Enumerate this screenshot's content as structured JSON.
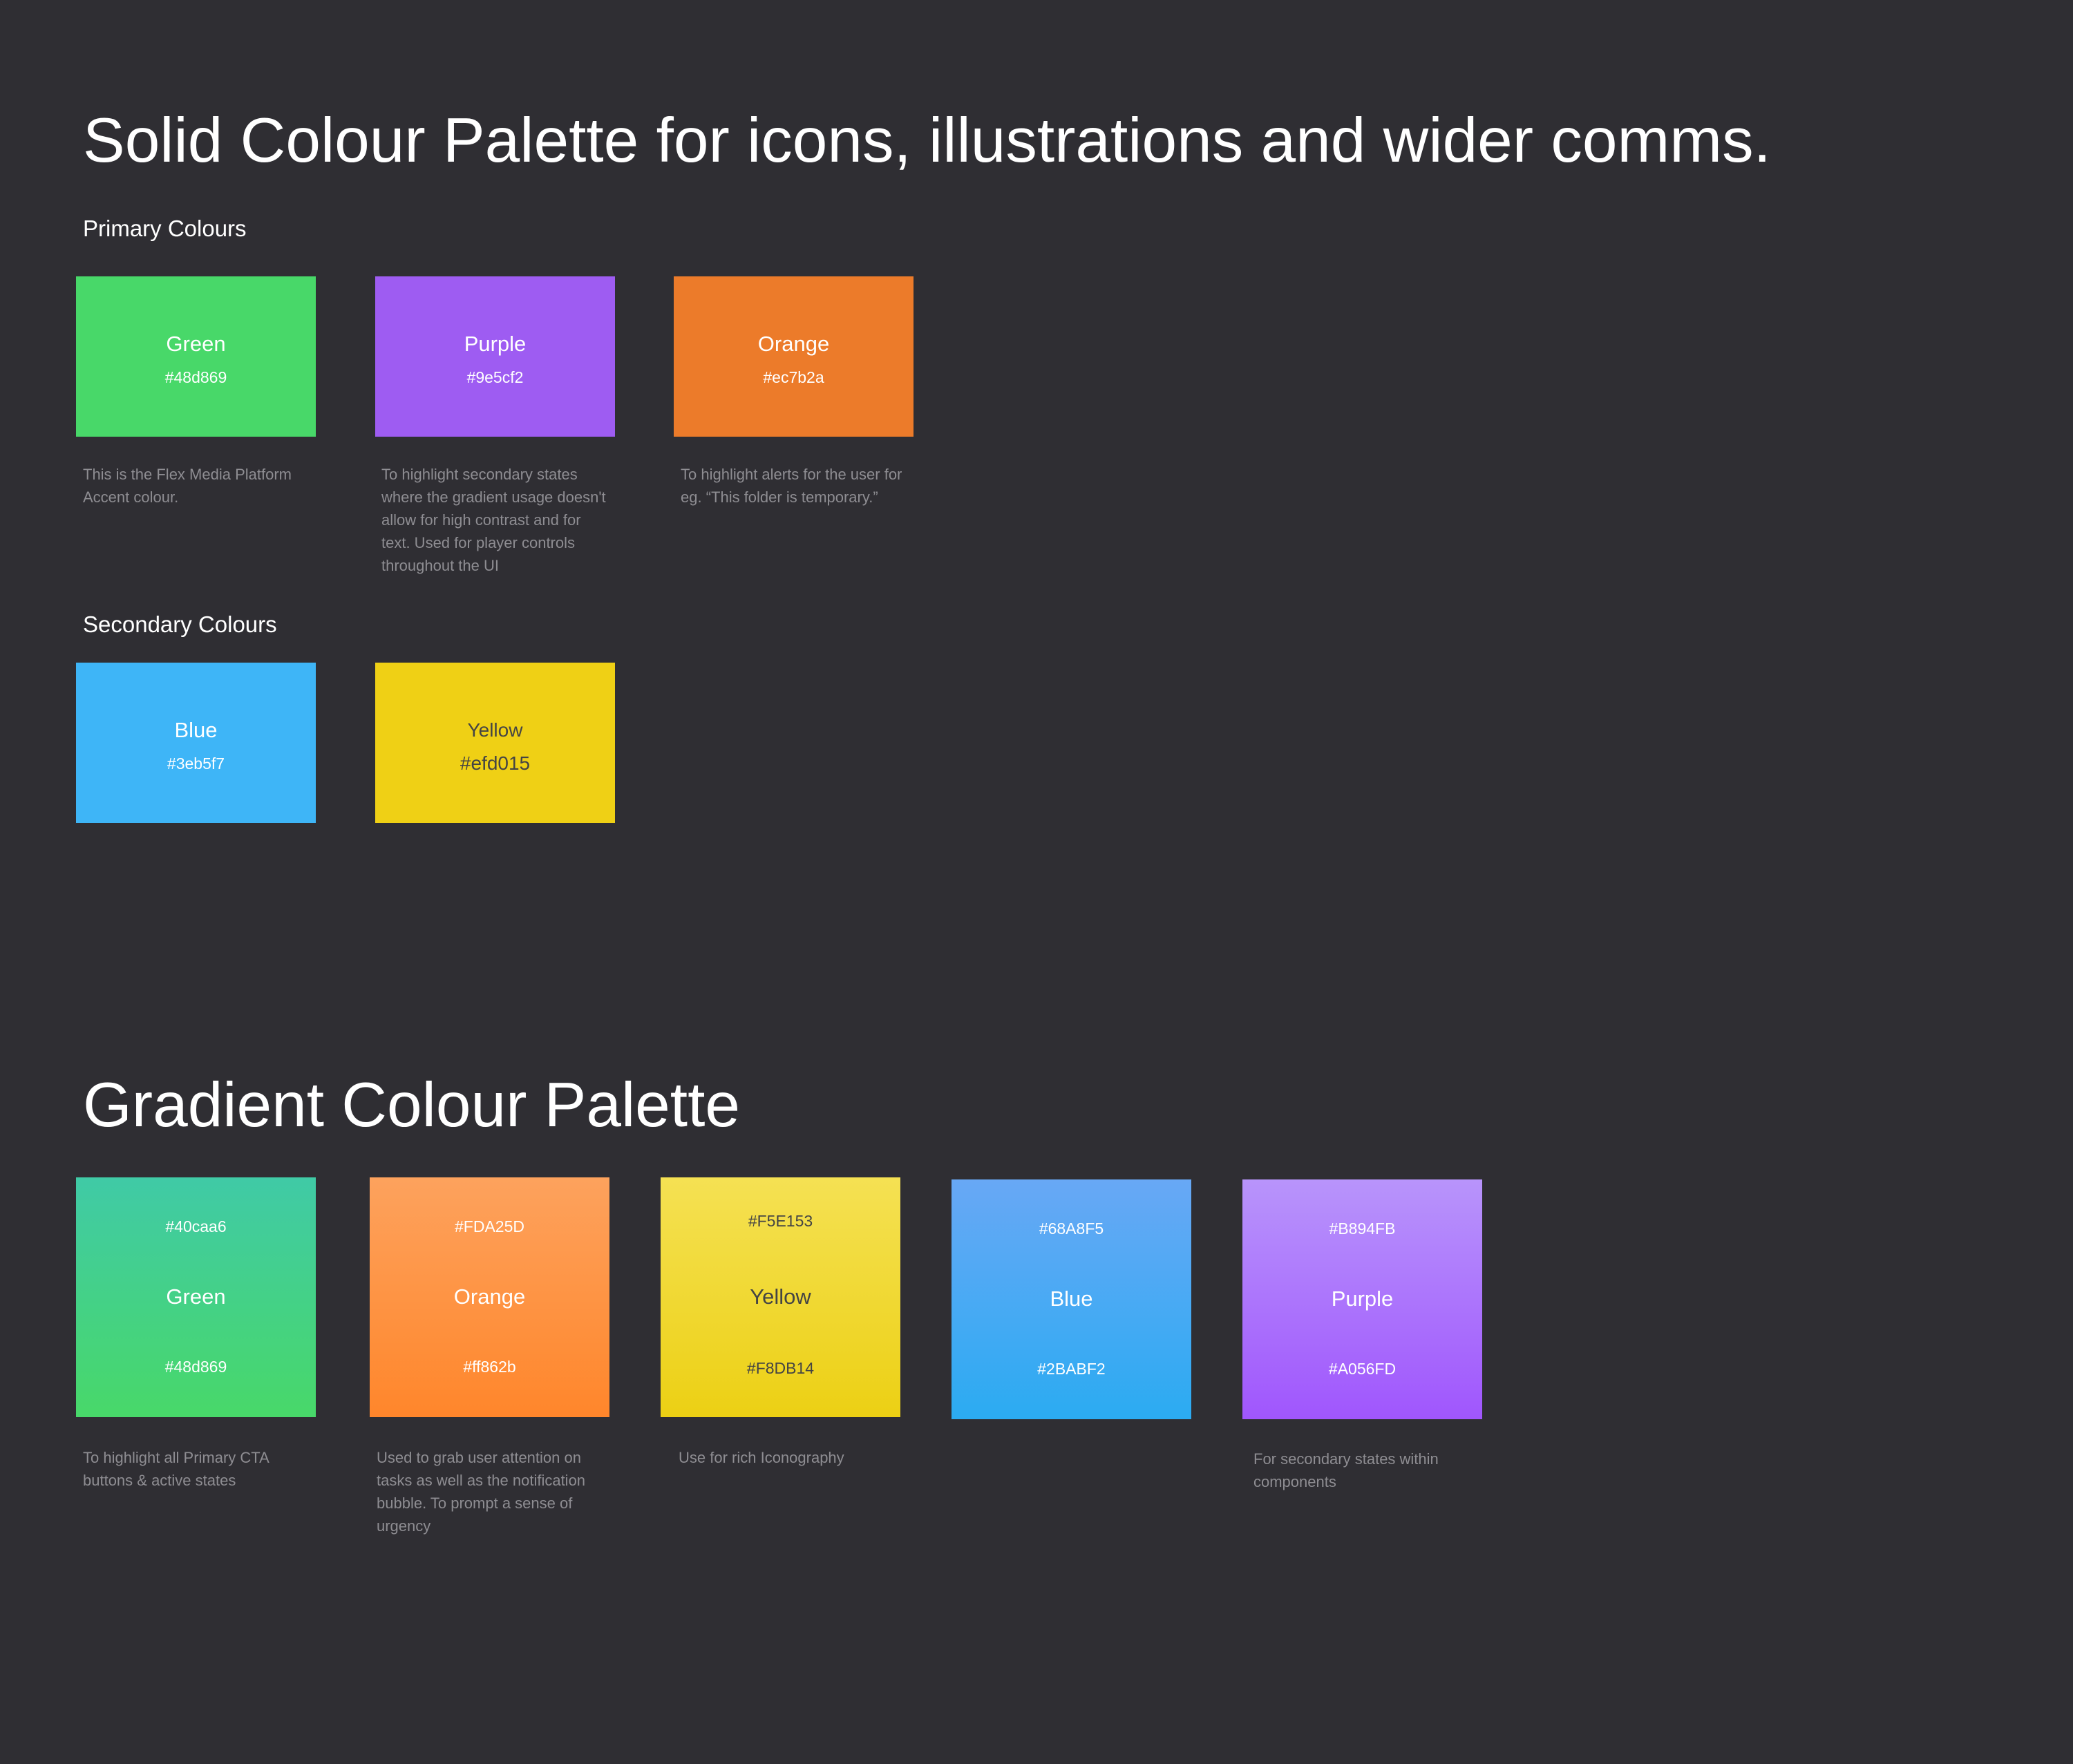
{
  "solid": {
    "title": "Solid Colour Palette for icons, illustrations and wider comms.",
    "primary_heading": "Primary Colours",
    "secondary_heading": "Secondary Colours",
    "primary": [
      {
        "name": "Green",
        "hex": "#48d869",
        "color": "#48d869",
        "text_color": "#ffffff",
        "description": "This is the Flex Media Platform Accent colour."
      },
      {
        "name": "Purple",
        "hex": "#9e5cf2",
        "color": "#9e5cf2",
        "text_color": "#ffffff",
        "description": "To highlight secondary states where the gradient usage doesn't allow for high contrast and for text. Used for player controls throughout the UI"
      },
      {
        "name": "Orange",
        "hex": "#ec7b2a",
        "color": "#ec7b2a",
        "text_color": "#ffffff",
        "description": "To highlight alerts for the user for eg. “This folder is temporary.”"
      }
    ],
    "secondary": [
      {
        "name": "Blue",
        "hex": "#3eb5f7",
        "color": "#3eb5f7",
        "text_color": "#ffffff"
      },
      {
        "name": "Yellow",
        "hex": "#efd015",
        "color": "#efd015",
        "text_color": "#444444"
      }
    ]
  },
  "gradient": {
    "title": "Gradient Colour Palette",
    "swatches": [
      {
        "name": "Green",
        "top_hex": "#40caa6",
        "bottom_hex": "#48d869",
        "top_color": "#40caa6",
        "bottom_color": "#48d869",
        "text_color": "#ffffff",
        "description": "To highlight all Primary CTA buttons & active states"
      },
      {
        "name": "Orange",
        "top_hex": "#FDA25D",
        "bottom_hex": "#ff862b",
        "top_color": "#FDA25D",
        "bottom_color": "#ff862b",
        "text_color": "#ffffff",
        "description": "Used to grab user attention on tasks as well as the notification bubble. To prompt a sense of urgency"
      },
      {
        "name": "Yellow",
        "top_hex": "#F5E153",
        "bottom_hex": "#F8DB14",
        "top_color": "#F5E153",
        "bottom_color": "#ecd014",
        "text_color": "#444444",
        "description": "Use for rich Iconography"
      },
      {
        "name": "Blue",
        "top_hex": "#68A8F5",
        "bottom_hex": "#2BABF2",
        "top_color": "#68A8F5",
        "bottom_color": "#2BABF2",
        "text_color": "#ffffff",
        "description": ""
      },
      {
        "name": "Purple",
        "top_hex": "#B894FB",
        "bottom_hex": "#A056FD",
        "top_color": "#B894FB",
        "bottom_color": "#A056FD",
        "text_color": "#ffffff",
        "description": "For secondary states within components"
      }
    ]
  }
}
